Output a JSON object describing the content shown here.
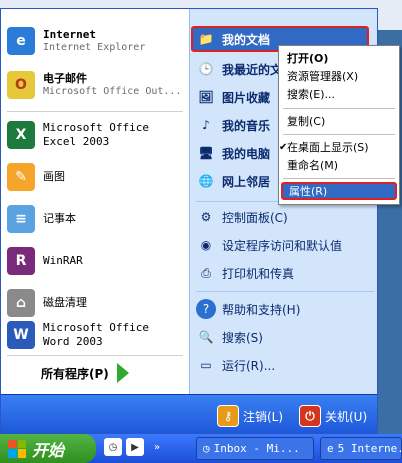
{
  "left": {
    "pinned": [
      {
        "main": "Internet",
        "sub": "Internet Explorer",
        "icon": "internet-explorer-icon"
      },
      {
        "main": "电子邮件",
        "sub": "Microsoft Office Out...",
        "icon": "outlook-icon"
      }
    ],
    "recent": [
      {
        "main": "Microsoft Office Excel 2003",
        "icon": "excel-icon"
      },
      {
        "main": "画图",
        "icon": "paint-icon"
      },
      {
        "main": "记事本",
        "icon": "notepad-icon"
      },
      {
        "main": "WinRAR",
        "icon": "winrar-icon"
      },
      {
        "main": "磁盘清理",
        "icon": "disk-cleanup-icon"
      },
      {
        "main": "Microsoft Office Word 2003",
        "icon": "word-icon"
      }
    ],
    "all_programs": "所有程序(P)"
  },
  "right": {
    "items": [
      {
        "label": "我的文档",
        "bold": true,
        "icon": "my-documents-icon"
      },
      {
        "label": "我最近的文档",
        "bold": true,
        "icon": "recent-documents-icon"
      },
      {
        "label": "图片收藏",
        "bold": true,
        "icon": "my-pictures-icon"
      },
      {
        "label": "我的音乐",
        "bold": true,
        "icon": "my-music-icon"
      },
      {
        "label": "我的电脑",
        "bold": true,
        "icon": "my-computer-icon"
      },
      {
        "label": "网上邻居",
        "bold": true,
        "icon": "network-places-icon"
      },
      {
        "label": "控制面板(C)",
        "bold": false,
        "icon": "control-panel-icon"
      },
      {
        "label": "设定程序访问和默认值",
        "bold": false,
        "icon": "program-defaults-icon"
      },
      {
        "label": "打印机和传真",
        "bold": false,
        "icon": "printer-icon"
      },
      {
        "label": "帮助和支持(H)",
        "bold": false,
        "icon": "help-icon"
      },
      {
        "label": "搜索(S)",
        "bold": false,
        "icon": "search-icon"
      },
      {
        "label": "运行(R)...",
        "bold": false,
        "icon": "run-icon"
      }
    ]
  },
  "context_menu": {
    "items": [
      {
        "label": "打开(O)",
        "bold": true
      },
      {
        "label": "资源管理器(X)"
      },
      {
        "label": "搜索(E)..."
      },
      {
        "label": "复制(C)"
      },
      {
        "label": "在桌面上显示(S)",
        "checked": true
      },
      {
        "label": "重命名(M)"
      },
      {
        "label": "属性(R)",
        "selected": true
      }
    ]
  },
  "bottom": {
    "logoff": "注销(L)",
    "shutdown": "关机(U)"
  },
  "taskbar": {
    "start": "开始",
    "windows": [
      {
        "label": "Inbox - Mi..."
      },
      {
        "label": "5 Interne..."
      }
    ]
  },
  "colors": {
    "accent": "#316ac5",
    "highlight_border": "#dd2222",
    "start_green": "#3c9d2a"
  }
}
